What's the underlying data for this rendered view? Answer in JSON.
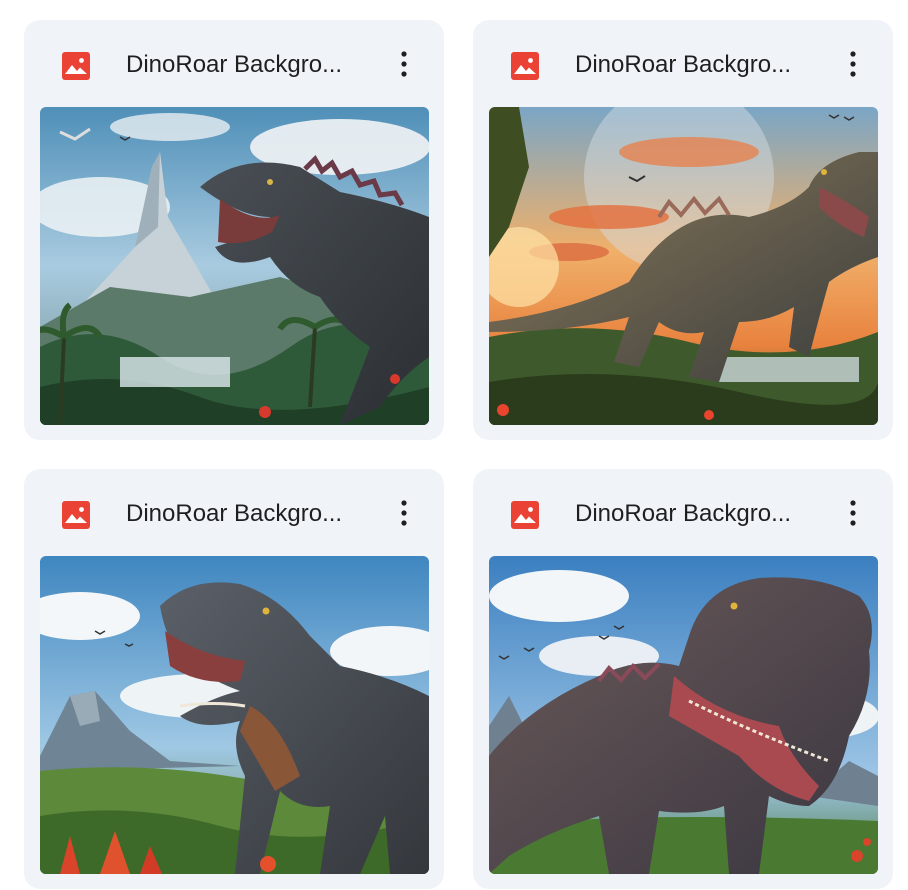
{
  "files": [
    {
      "title": "DinoRoar Backgro...",
      "icon": "image-file-icon",
      "menu_icon": "more-vert-icon"
    },
    {
      "title": "DinoRoar Backgro...",
      "icon": "image-file-icon",
      "menu_icon": "more-vert-icon"
    },
    {
      "title": "DinoRoar Backgro...",
      "icon": "image-file-icon",
      "menu_icon": "more-vert-icon"
    },
    {
      "title": "DinoRoar Backgro...",
      "icon": "image-file-icon",
      "menu_icon": "more-vert-icon"
    }
  ],
  "colors": {
    "card_background": "#f0f4f9",
    "image_icon_red": "#ea4335",
    "title_text": "#1f1f1f"
  }
}
